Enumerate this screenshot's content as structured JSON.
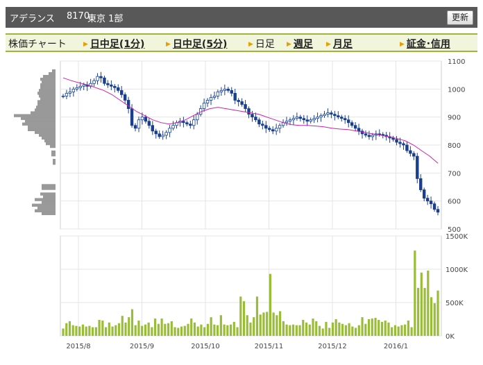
{
  "header": {
    "company": "アデランス",
    "code": "8170",
    "market": "東京 1部",
    "refresh_label": "更新"
  },
  "nav": {
    "title": "株価チャート",
    "items": [
      {
        "label": "日中足(1分)",
        "link": true
      },
      {
        "label": "日中足(5分)",
        "link": true
      },
      {
        "label": "日足",
        "link": false
      },
      {
        "label": "週足",
        "link": true
      },
      {
        "label": "月足",
        "link": true
      },
      {
        "label": "証金･信用",
        "link": true
      }
    ]
  },
  "colors": {
    "candle": "#1a3f8c",
    "ma": "#cc22aa",
    "volume": "#9abd38",
    "volume_profile": "#999999",
    "grid": "#e4e4e4"
  },
  "chart_data": [
    {
      "type": "candlestick",
      "title": "",
      "y_ticks": [
        500,
        600,
        700,
        800,
        900,
        1000,
        1100
      ],
      "ylim": [
        500,
        1100
      ],
      "x_labels": [
        "2015/8",
        "2015/9",
        "2015/10",
        "2015/11",
        "2015/12",
        "2016/1"
      ],
      "close": [
        975,
        985,
        990,
        1000,
        1005,
        1010,
        1015,
        1010,
        1020,
        1030,
        1045,
        1040,
        1020,
        1015,
        1010,
        1005,
        995,
        980,
        960,
        930,
        870,
        860,
        890,
        900,
        885,
        870,
        850,
        840,
        830,
        835,
        845,
        860,
        870,
        880,
        885,
        880,
        875,
        870,
        890,
        910,
        930,
        950,
        960,
        970,
        975,
        990,
        995,
        1000,
        995,
        985,
        960,
        955,
        945,
        930,
        910,
        900,
        890,
        875,
        870,
        860,
        855,
        850,
        860,
        870,
        880,
        885,
        890,
        895,
        900,
        895,
        890,
        885,
        890,
        895,
        900,
        905,
        910,
        915,
        910,
        905,
        900,
        895,
        890,
        880,
        870,
        860,
        850,
        840,
        835,
        830,
        835,
        840,
        838,
        835,
        830,
        825,
        820,
        810,
        805,
        800,
        780,
        770,
        760,
        680,
        640,
        610,
        600,
        590,
        570,
        560
      ],
      "ma": [
        1040,
        1030,
        1022,
        1015,
        1005,
        995,
        980,
        960,
        940,
        920,
        905,
        890,
        880,
        875,
        880,
        890,
        905,
        920,
        930,
        935,
        930,
        925,
        920,
        915,
        910,
        900,
        890,
        880,
        873,
        870,
        870,
        868,
        865,
        860,
        857,
        855,
        850,
        845,
        840,
        835,
        830,
        823,
        815,
        800,
        780,
        760,
        735
      ],
      "candles_range_note": "daily candles from 2015/7 to 2016/1"
    },
    {
      "type": "bar",
      "title": "",
      "y_ticks": [
        "0K",
        "500K",
        "1000K",
        "1500K"
      ],
      "ylim": [
        0,
        1500
      ],
      "unit": "K",
      "values": [
        110,
        190,
        220,
        160,
        150,
        140,
        170,
        140,
        150,
        130,
        130,
        240,
        230,
        130,
        200,
        140,
        160,
        190,
        300,
        200,
        280,
        400,
        160,
        230,
        150,
        170,
        200,
        130,
        260,
        180,
        260,
        180,
        190,
        220,
        130,
        120,
        140,
        150,
        180,
        260,
        200,
        140,
        170,
        130,
        180,
        280,
        170,
        160,
        310,
        170,
        160,
        170,
        210,
        130,
        590,
        520,
        310,
        200,
        280,
        590,
        320,
        350,
        360,
        930,
        350,
        310,
        370,
        220,
        170,
        160,
        170,
        160,
        160,
        240,
        200,
        170,
        260,
        220,
        150,
        110,
        210,
        120,
        200,
        250,
        200,
        180,
        160,
        190,
        140,
        120,
        160,
        280,
        180,
        250,
        260,
        270,
        240,
        210,
        230,
        200,
        130,
        160,
        140,
        160,
        170,
        230,
        130,
        1280,
        720,
        950,
        720,
        980,
        580,
        490,
        680
      ]
    }
  ]
}
